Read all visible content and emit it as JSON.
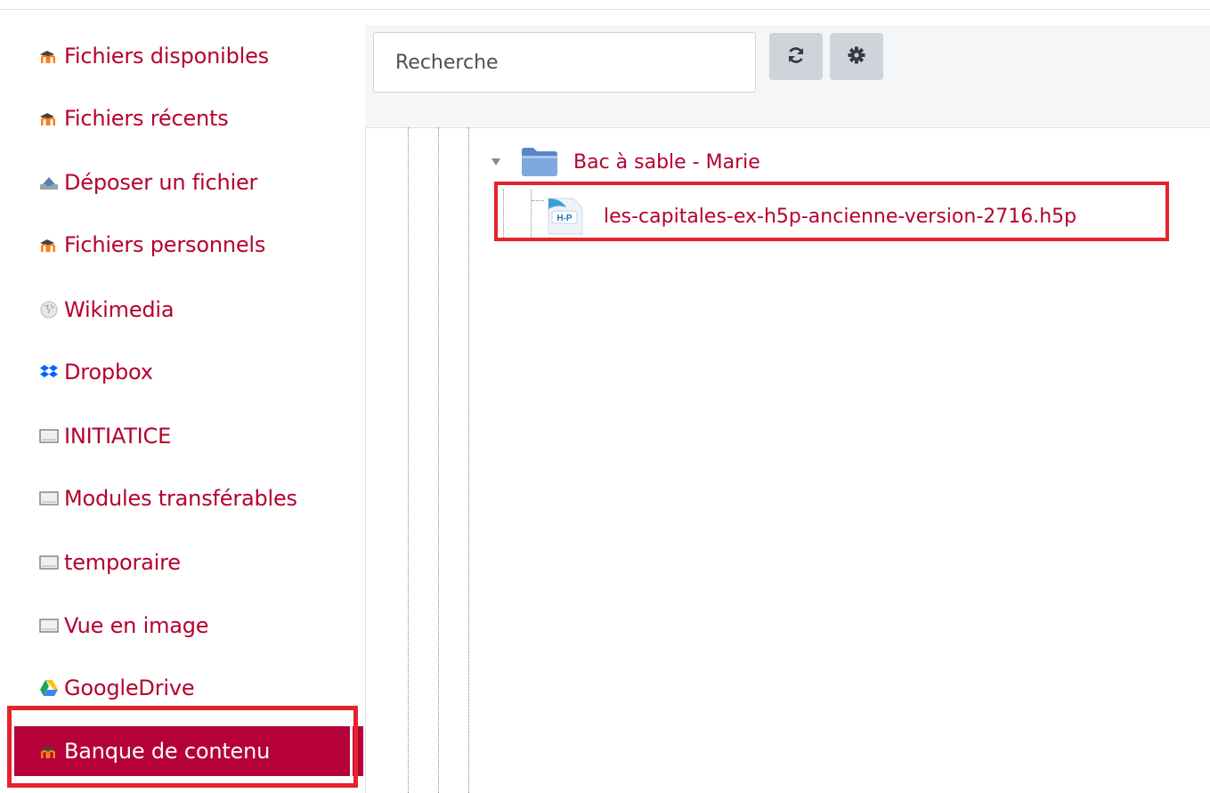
{
  "repositories": [
    {
      "label": "Fichiers disponibles",
      "icon": "moodle-icon"
    },
    {
      "label": "Fichiers récents",
      "icon": "moodle-icon"
    },
    {
      "label": "Déposer un fichier",
      "icon": "upload-icon"
    },
    {
      "label": "Fichiers personnels",
      "icon": "moodle-icon"
    },
    {
      "label": "Wikimedia",
      "icon": "wikimedia-icon"
    },
    {
      "label": "Dropbox",
      "icon": "dropbox-icon"
    },
    {
      "label": "INITIATICE",
      "icon": "repository-icon"
    },
    {
      "label": "Modules transférables",
      "icon": "repository-icon"
    },
    {
      "label": "temporaire",
      "icon": "repository-icon"
    },
    {
      "label": "Vue en image",
      "icon": "repository-icon"
    },
    {
      "label": "GoogleDrive",
      "icon": "google-drive-icon"
    },
    {
      "label": "Banque de contenu",
      "icon": "moodle-icon",
      "active": true
    }
  ],
  "search": {
    "placeholder": "Recherche"
  },
  "toolbar": {
    "refresh_icon": "refresh-icon",
    "settings_icon": "gear-icon"
  },
  "tree": {
    "folder": {
      "label": "Bac à sable - Marie",
      "icon": "folder-icon",
      "expanded": true
    },
    "file": {
      "label": "les-capitales-ex-h5p-ancienne-version-2716.h5p",
      "icon": "h5p-file-icon",
      "badge": "H-P"
    }
  },
  "colors": {
    "accent": "#b5002f",
    "active_bg": "#b5003a",
    "highlight": "#e4232b"
  }
}
